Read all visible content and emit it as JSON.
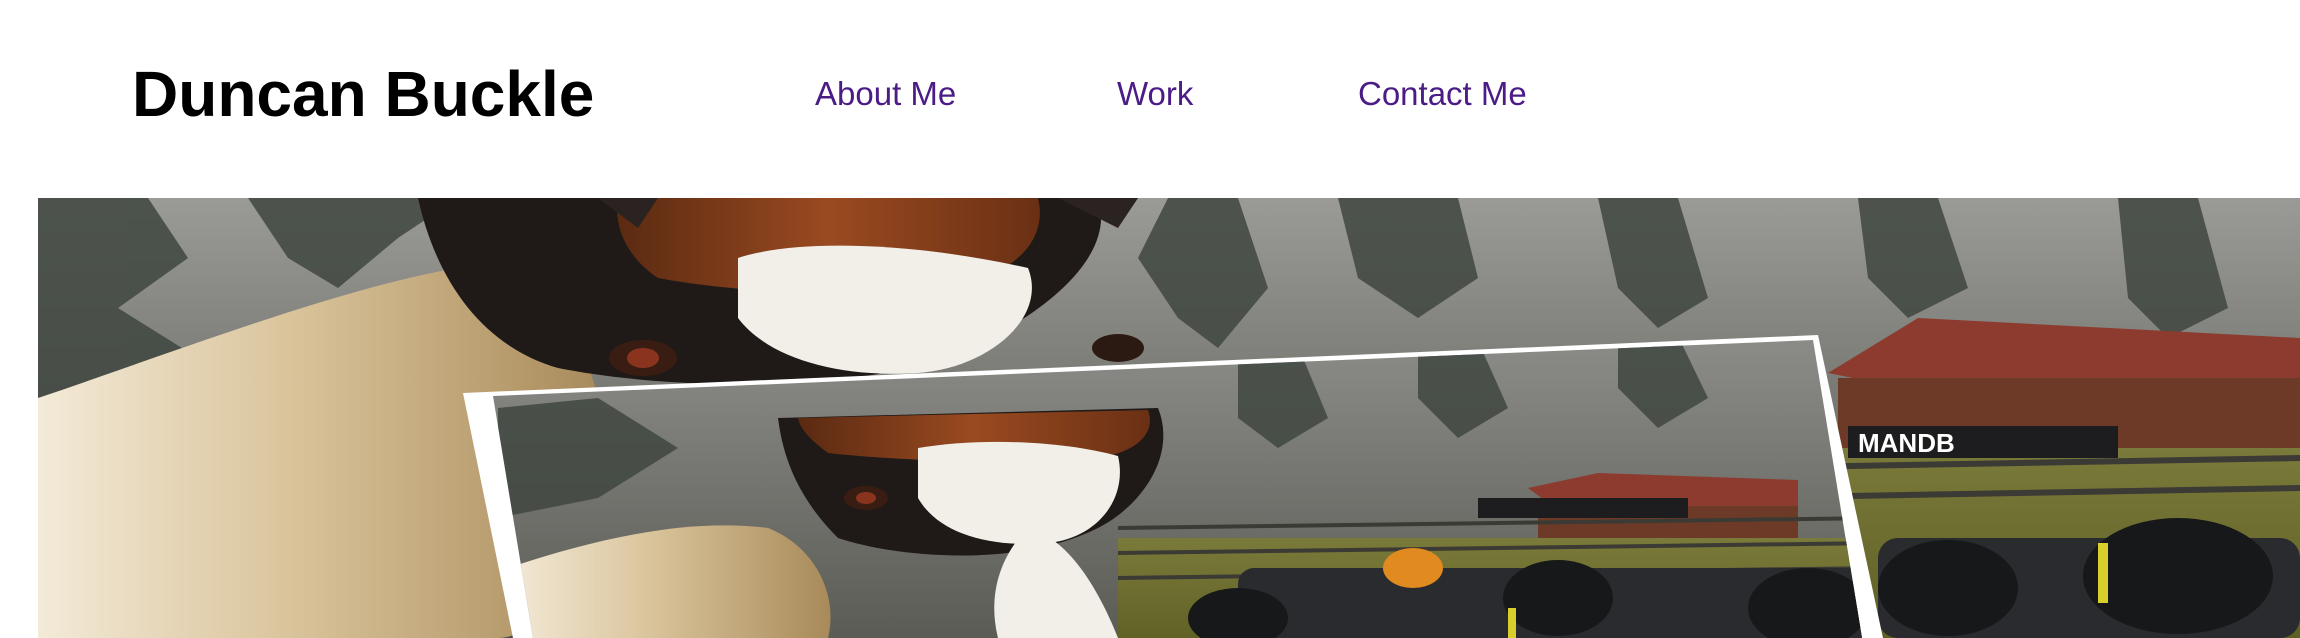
{
  "header": {
    "site_title": "Duncan Buckle",
    "nav": [
      {
        "label": "About Me"
      },
      {
        "label": "Work"
      },
      {
        "label": "Contact Me"
      }
    ],
    "link_color": "#4b1c86"
  },
  "hero": {
    "image_description_icon": "horse-and-race-car-collage",
    "sticker_text": "MANDB"
  }
}
